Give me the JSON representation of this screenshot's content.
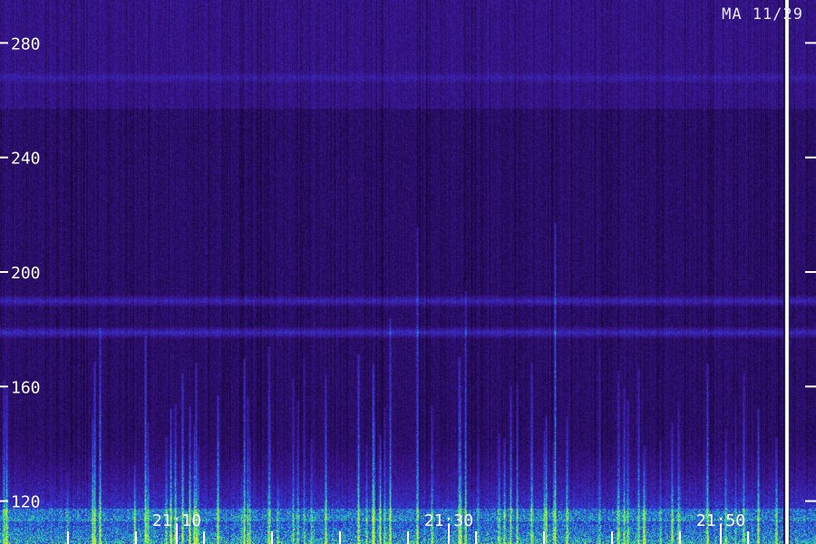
{
  "chart_data": {
    "type": "heatmap",
    "title": "MA 11/29",
    "xlabel": "",
    "ylabel": "",
    "x_ticks": [
      "21:10",
      "21:30",
      "21:50"
    ],
    "y_ticks": [
      280,
      240,
      200,
      160,
      120
    ],
    "xlim_minutes": [
      20.95,
      21.95
    ],
    "ylim": [
      105,
      295
    ],
    "colormap": [
      "#12052e",
      "#3a1590",
      "#3040e0",
      "#20b4c8",
      "#60f060",
      "#f0f020"
    ],
    "horizontal_bands": [
      {
        "y": 268,
        "intensity": 0.25
      },
      {
        "y": 190,
        "intensity": 0.55
      },
      {
        "y": 179,
        "intensity": 0.6
      }
    ],
    "interference_column_label": "",
    "grid": false,
    "legend": "none"
  }
}
